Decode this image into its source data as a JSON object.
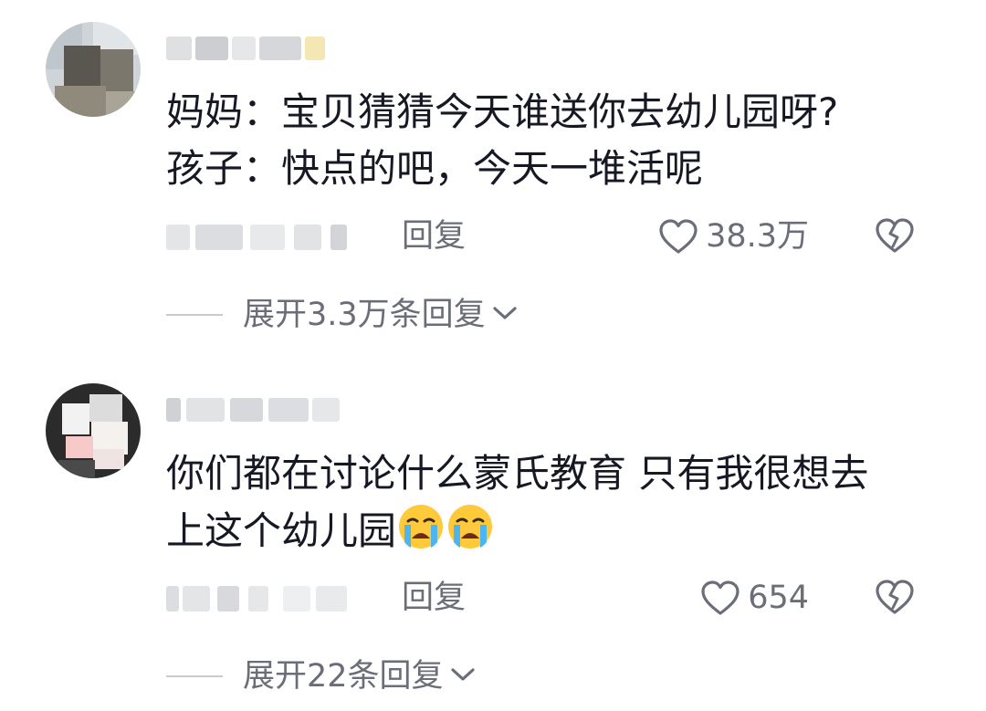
{
  "comments": [
    {
      "lines": [
        "妈妈：宝贝猜猜今天谁送你去幼儿园呀?",
        "孩子：快点的吧，今天一堆活呢"
      ],
      "reply_label": "回复",
      "likes": "38.3万",
      "expand_label": "展开3.3万条回复"
    },
    {
      "lines": [
        "你们都在讨论什么蒙氏教育 只有我很想去",
        "上这个幼儿园"
      ],
      "emojis": [
        "crying-face-emoji",
        "crying-face-emoji"
      ],
      "reply_label": "回复",
      "likes": "654",
      "expand_label": "展开22条回复"
    }
  ],
  "colors": {
    "text": "#161823",
    "secondary": "#6b6e78",
    "divider": "#c9cacd"
  }
}
